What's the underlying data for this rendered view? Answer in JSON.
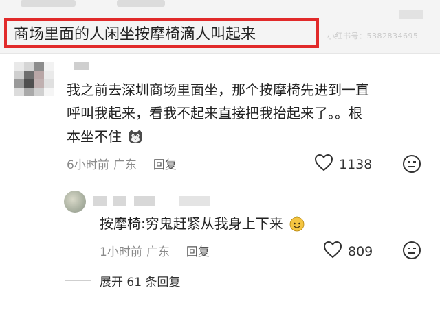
{
  "header": {
    "title": "商场里面的人闲坐按摩椅滴人叫起来",
    "watermark": "小红书号：5382834695"
  },
  "comment": {
    "text": "我之前去深圳商场里面坐，那个按摩椅先进到一直呼叫我起来，看我不起来直接把我抬起来了。。根本坐不住",
    "emoji": "cat-face-emoji",
    "time": "6小时前",
    "location": "广东",
    "reply_label": "回复",
    "likes": "1138"
  },
  "reply": {
    "text": "按摩椅:穷鬼赶紧从我身上下来",
    "emoji": "smiling-face-emoji",
    "time": "1小时前",
    "location": "广东",
    "reply_label": "回复",
    "likes": "809"
  },
  "expand": {
    "label": "展开 61 条回复"
  },
  "colors": {
    "highlight_border": "#e12a2a",
    "meta_text": "#8a8a8a"
  }
}
